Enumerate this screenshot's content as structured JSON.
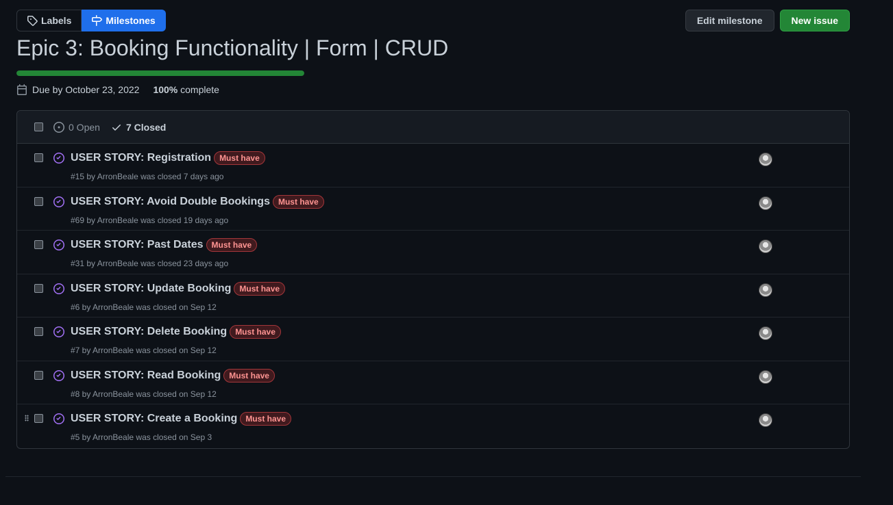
{
  "nav": {
    "labels": "Labels",
    "milestones": "Milestones"
  },
  "actions": {
    "edit": "Edit milestone",
    "new_issue": "New issue"
  },
  "milestone": {
    "title": "Epic 3: Booking Functionality | Form | CRUD",
    "due": "Due by October 23, 2022",
    "percent": "100%",
    "complete_label": "complete",
    "progress_fraction": 1.0
  },
  "states": {
    "open": "0 Open",
    "closed": "7 Closed"
  },
  "issues": [
    {
      "title": "USER STORY: Registration",
      "label": "Must have",
      "meta": "#15 by ArronBeale was closed 7 days ago"
    },
    {
      "title": "USER STORY: Avoid Double Bookings",
      "label": "Must have",
      "meta": "#69 by ArronBeale was closed 19 days ago"
    },
    {
      "title": "USER STORY: Past Dates",
      "label": "Must have",
      "meta": "#31 by ArronBeale was closed 23 days ago"
    },
    {
      "title": "USER STORY: Update Booking",
      "label": "Must have",
      "meta": "#6 by ArronBeale was closed on Sep 12"
    },
    {
      "title": "USER STORY: Delete Booking",
      "label": "Must have",
      "meta": "#7 by ArronBeale was closed on Sep 12"
    },
    {
      "title": "USER STORY: Read Booking",
      "label": "Must have",
      "meta": "#8 by ArronBeale was closed on Sep 12"
    },
    {
      "title": "USER STORY: Create a Booking",
      "label": "Must have",
      "meta": "#5 by ArronBeale was closed on Sep 3"
    }
  ],
  "icons": {
    "labels": "tag-icon",
    "milestones": "milestone-icon",
    "due": "calendar-icon",
    "open": "issue-open-icon",
    "closed": "check-icon",
    "issue_state": "issue-closed-icon"
  },
  "colors": {
    "background": "#0d1117",
    "accent_blue": "#1f6feb",
    "success_green": "#238636",
    "closed_purple": "#a371f7",
    "label_red": "#ff9492"
  }
}
